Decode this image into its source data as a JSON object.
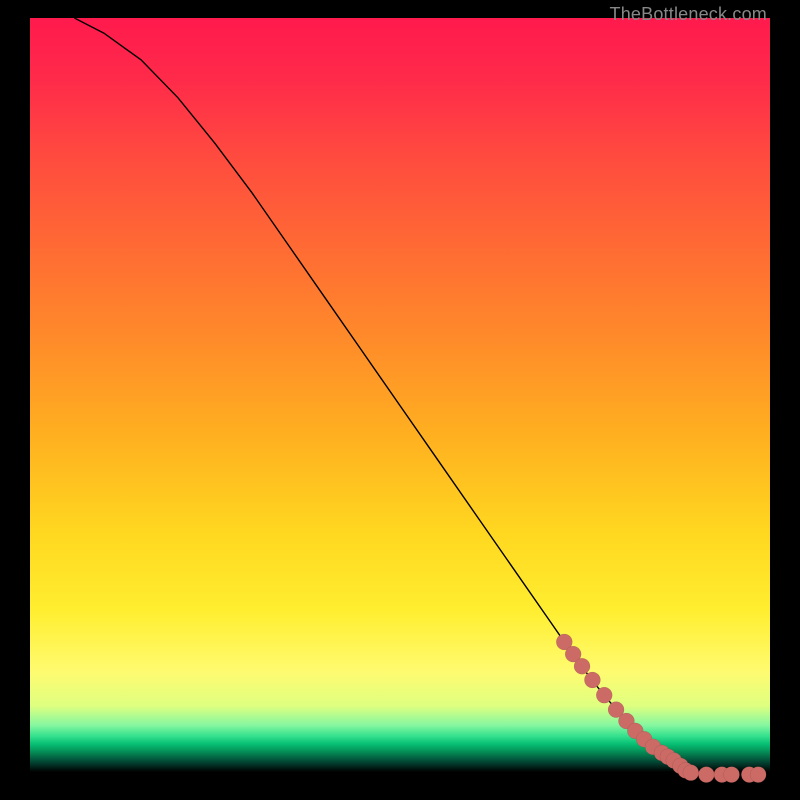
{
  "attribution": "TheBottleneck.com",
  "chart_data": {
    "type": "line",
    "title": "",
    "xlabel": "",
    "ylabel": "",
    "xlim": [
      0,
      100
    ],
    "ylim": [
      0,
      100
    ],
    "grid": false,
    "legend": false,
    "series": [
      {
        "name": "curve",
        "type": "line",
        "color": "#000000",
        "x_pct": [
          6,
          10,
          15,
          20,
          25,
          30,
          35,
          40,
          45,
          50,
          55,
          60,
          65,
          70,
          72,
          74,
          76,
          78,
          80,
          82,
          84,
          86,
          87,
          88,
          90,
          92,
          94,
          96,
          98,
          100
        ],
        "y_pct": [
          100,
          98,
          94.5,
          89.5,
          83.5,
          77,
          70,
          63,
          56,
          49,
          42,
          35,
          28,
          21,
          18.2,
          15.4,
          12.8,
          10.4,
          8.2,
          6.4,
          4.8,
          3.4,
          2.8,
          2.0,
          1.1,
          0.55,
          0.3,
          0.2,
          0.15,
          0.13
        ]
      },
      {
        "name": "points",
        "type": "scatter",
        "color": "#cc6b66",
        "radius": 8,
        "x_pct": [
          72.2,
          73.4,
          74.6,
          76.0,
          77.6,
          79.2,
          80.6,
          81.8,
          83.0,
          84.2,
          85.4,
          86.2,
          87.0,
          87.9,
          88.6,
          89.3,
          91.4,
          93.5,
          94.8,
          97.2,
          98.4
        ],
        "y_pct": [
          17.9,
          16.3,
          14.7,
          12.9,
          10.9,
          9.0,
          7.5,
          6.2,
          5.1,
          4.1,
          3.3,
          2.8,
          2.3,
          1.6,
          1.0,
          0.7,
          0.45,
          0.45,
          0.45,
          0.45,
          0.45
        ]
      }
    ]
  }
}
